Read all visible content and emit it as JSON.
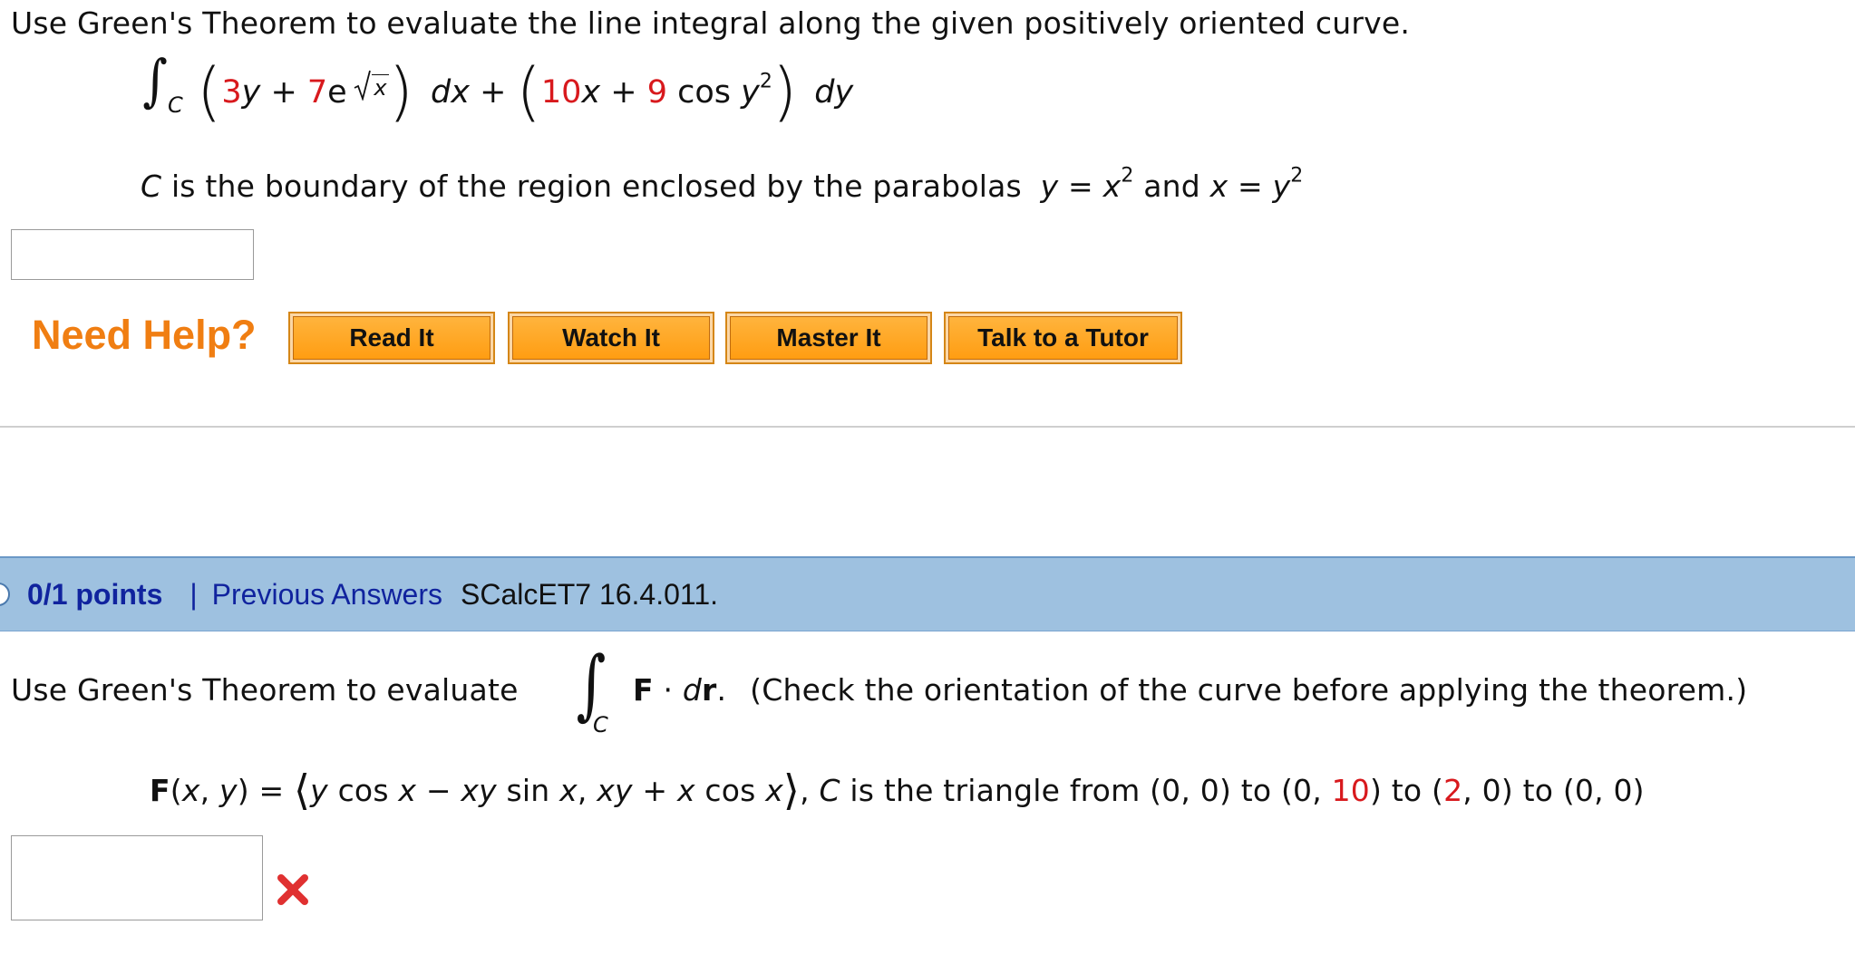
{
  "problem1": {
    "instruction": "Use Green's Theorem to evaluate the line integral along the given positively oriented curve.",
    "integral_symbol": "∫",
    "integral_subscript": "C",
    "open_paren": "(",
    "close_paren": ")",
    "p_coef": "3",
    "p_var": "y",
    "plus1": " + ",
    "e_coef": "7",
    "e_base": "e",
    "sqrt_arg": "x",
    "dx": "dx",
    "plus2": " + ",
    "q_coef1": "10",
    "q_var1": "x",
    "plus3": " + ",
    "q_coef2": "9",
    "cos_text": " cos ",
    "q_var2": "y",
    "exp2": "2",
    "dy": "dy",
    "condition_pre": "C",
    "condition_text": " is the boundary of the region enclosed by the parabolas ",
    "curve1_lhs": "y",
    "curve1_eq": " = ",
    "curve1_var": "x",
    "curve1_exp": "2",
    "and_text": " and ",
    "curve2_lhs": "x",
    "curve2_eq": " = ",
    "curve2_var": "y",
    "curve2_exp": "2",
    "answer_value": ""
  },
  "help": {
    "label": "Need Help?",
    "buttons": [
      "Read It",
      "Watch It",
      "Master It",
      "Talk to a Tutor"
    ]
  },
  "problem2": {
    "points": "0/1 points",
    "separator": "|",
    "previous_answers": "Previous Answers",
    "reference": "SCalcET7 16.4.011.",
    "instruction": "Use Green's Theorem to evaluate",
    "integral_symbol": "∫",
    "integral_subscript": "C",
    "F_bold": "F",
    "dot": " · ",
    "d_text": "d",
    "r_bold": "r",
    "period": ".",
    "note": "(Check the orientation of the curve before applying the theorem.)",
    "field_F": "F",
    "field_args": "(x, y) = ",
    "langle": "⟨",
    "comp1_a": "y",
    "comp1_b": " cos ",
    "comp1_c": "x",
    "comp1_d": " − ",
    "comp1_e": "xy",
    "comp1_f": " sin ",
    "comp1_g": "x",
    "comma": ", ",
    "comp2_a": "xy",
    "comp2_b": " + ",
    "comp2_c": "x",
    "comp2_d": " cos ",
    "comp2_e": "x",
    "rangle": "⟩",
    "tri_c": "C",
    "tri_text1": " is the triangle from (0, 0) to (0, ",
    "tri_v1": "10",
    "tri_text2": ") to (",
    "tri_v2": "2",
    "tri_text3": ", 0) to (0, 0)",
    "answer_value": "",
    "status_icon": "x-mark-icon",
    "status_color": "#e03131"
  }
}
